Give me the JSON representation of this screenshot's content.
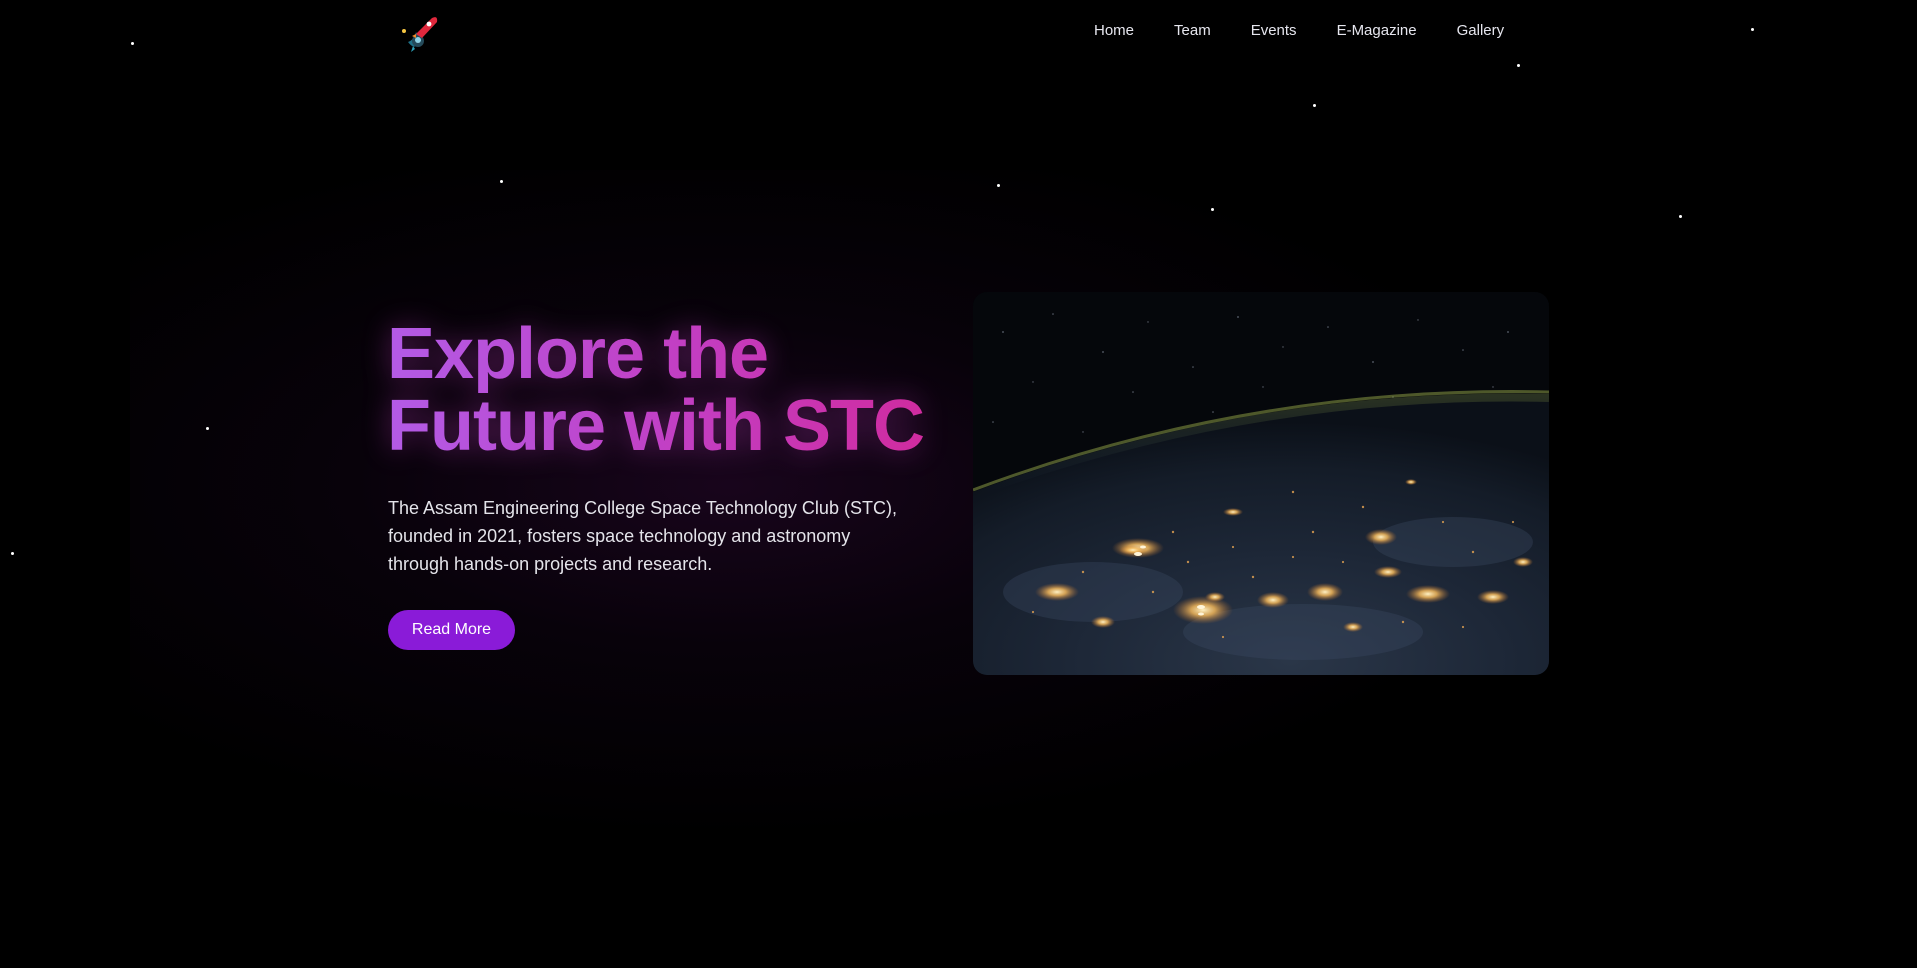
{
  "nav": {
    "logo_icon": "rocket-logo-icon",
    "links": [
      {
        "label": "Home"
      },
      {
        "label": "Team"
      },
      {
        "label": "Events"
      },
      {
        "label": "E-Magazine"
      },
      {
        "label": "Gallery"
      }
    ]
  },
  "hero": {
    "title_line1": "Explore the",
    "title_line2": "Future with STC",
    "description": "The Assam Engineering College Space Technology Club (STC), founded in 2021, fosters space technology and astronomy through hands-on projects and research.",
    "button_label": "Read More",
    "image_subject": "earth-at-night-image"
  },
  "colors": {
    "background": "#000000",
    "accent": "#8a1bd8",
    "title_gradient_start": "#b35be6",
    "title_gradient_end": "#d12a9c"
  }
}
